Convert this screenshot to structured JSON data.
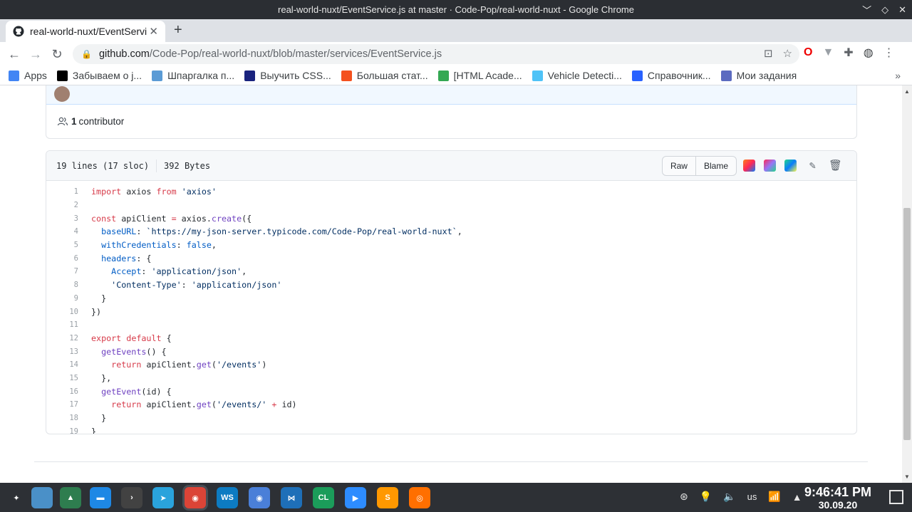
{
  "window": {
    "title": "real-world-nuxt/EventService.js at master · Code-Pop/real-world-nuxt - Google Chrome",
    "controls": [
      "﹀",
      "◇",
      "✕"
    ]
  },
  "tab": {
    "title": "real-world-nuxt/EventService.js at m",
    "close": "✕",
    "new_tab": "+"
  },
  "toolbar": {
    "back": "←",
    "forward": "→",
    "reload": "↻",
    "url_host": "github.com",
    "url_path": "/Code-Pop/real-world-nuxt/blob/master/services/EventService.js"
  },
  "bookmarks": {
    "items": [
      {
        "label": "Apps",
        "color": "#4285f4"
      },
      {
        "label": "Забываем о j...",
        "color": "#000000"
      },
      {
        "label": "Шпаргалка п...",
        "color": "#5b9bd5"
      },
      {
        "label": "Выучить CSS...",
        "color": "#1a237e"
      },
      {
        "label": "Большая стат...",
        "color": "#f4511e"
      },
      {
        "label": "[HTML Acade...",
        "color": "#34a853"
      },
      {
        "label": "Vehicle Detecti...",
        "color": "#4fc3f7"
      },
      {
        "label": "Справочник...",
        "color": "#2962ff"
      },
      {
        "label": "Мои задания",
        "color": "#5c6bc0"
      }
    ],
    "more": "»"
  },
  "contributors": {
    "count": "1",
    "label": "contributor"
  },
  "file": {
    "lines_info": "19 lines (17 sloc)",
    "size": "392 Bytes",
    "raw_label": "Raw",
    "blame_label": "Blame"
  },
  "code": [
    [
      {
        "t": "import",
        "c": "kw"
      },
      {
        "t": " axios "
      },
      {
        "t": "from",
        "c": "kw"
      },
      {
        "t": " "
      },
      {
        "t": "'axios'",
        "c": "str"
      }
    ],
    [],
    [
      {
        "t": "const",
        "c": "kw"
      },
      {
        "t": " apiClient "
      },
      {
        "t": "=",
        "c": "kw"
      },
      {
        "t": " axios."
      },
      {
        "t": "create",
        "c": "fn"
      },
      {
        "t": "({"
      }
    ],
    [
      {
        "t": "  "
      },
      {
        "t": "baseURL",
        "c": "prop"
      },
      {
        "t": ": "
      },
      {
        "t": "`https://my-json-server.typicode.com/Code-Pop/real-world-nuxt`",
        "c": "str"
      },
      {
        "t": ","
      }
    ],
    [
      {
        "t": "  "
      },
      {
        "t": "withCredentials",
        "c": "prop"
      },
      {
        "t": ": "
      },
      {
        "t": "false",
        "c": "prop"
      },
      {
        "t": ","
      }
    ],
    [
      {
        "t": "  "
      },
      {
        "t": "headers",
        "c": "prop"
      },
      {
        "t": ": {"
      }
    ],
    [
      {
        "t": "    "
      },
      {
        "t": "Accept",
        "c": "prop"
      },
      {
        "t": ": "
      },
      {
        "t": "'application/json'",
        "c": "str"
      },
      {
        "t": ","
      }
    ],
    [
      {
        "t": "    "
      },
      {
        "t": "'Content-Type'",
        "c": "str"
      },
      {
        "t": ": "
      },
      {
        "t": "'application/json'",
        "c": "str"
      }
    ],
    [
      {
        "t": "  }"
      }
    ],
    [
      {
        "t": "})"
      }
    ],
    [],
    [
      {
        "t": "export",
        "c": "kw"
      },
      {
        "t": " "
      },
      {
        "t": "default",
        "c": "kw"
      },
      {
        "t": " {"
      }
    ],
    [
      {
        "t": "  "
      },
      {
        "t": "getEvents",
        "c": "fn"
      },
      {
        "t": "() {"
      }
    ],
    [
      {
        "t": "    "
      },
      {
        "t": "return",
        "c": "kw"
      },
      {
        "t": " apiClient."
      },
      {
        "t": "get",
        "c": "fn"
      },
      {
        "t": "("
      },
      {
        "t": "'/events'",
        "c": "str"
      },
      {
        "t": ")"
      }
    ],
    [
      {
        "t": "  },"
      }
    ],
    [
      {
        "t": "  "
      },
      {
        "t": "getEvent",
        "c": "fn"
      },
      {
        "t": "(id) {"
      }
    ],
    [
      {
        "t": "    "
      },
      {
        "t": "return",
        "c": "kw"
      },
      {
        "t": " apiClient."
      },
      {
        "t": "get",
        "c": "fn"
      },
      {
        "t": "("
      },
      {
        "t": "'/events/'",
        "c": "str"
      },
      {
        "t": " "
      },
      {
        "t": "+",
        "c": "kw"
      },
      {
        "t": " id)"
      }
    ],
    [
      {
        "t": "  }"
      }
    ],
    [
      {
        "t": "}"
      }
    ]
  ],
  "taskbar": {
    "apps": [
      {
        "name": "launcher",
        "label": "✦",
        "color": "#2d3035"
      },
      {
        "name": "desktop-pager",
        "label": "",
        "color": "#4a90c8"
      },
      {
        "name": "files",
        "label": "▲",
        "color": "#2e7d4f"
      },
      {
        "name": "file-manager",
        "label": "▬",
        "color": "#1e88e5"
      },
      {
        "name": "terminal",
        "label": "›",
        "color": "#424242"
      },
      {
        "name": "telegram",
        "label": "➤",
        "color": "#2aa3dc"
      },
      {
        "name": "chrome",
        "label": "◉",
        "color": "#db4437"
      },
      {
        "name": "webstorm",
        "label": "WS",
        "color": "#0d7bc2"
      },
      {
        "name": "chromium",
        "label": "◉",
        "color": "#4a7fd8"
      },
      {
        "name": "vscode",
        "label": "⋈",
        "color": "#1e6fb8"
      },
      {
        "name": "clion",
        "label": "CL",
        "color": "#1b9c5a"
      },
      {
        "name": "zoom",
        "label": "▶",
        "color": "#2d8cff"
      },
      {
        "name": "sublime",
        "label": "S",
        "color": "#ff9800"
      },
      {
        "name": "firefox",
        "label": "◎",
        "color": "#ff6f00"
      }
    ],
    "keyboard_layout": "us",
    "time": "9:46:41 PM",
    "date": "30.09.20"
  }
}
